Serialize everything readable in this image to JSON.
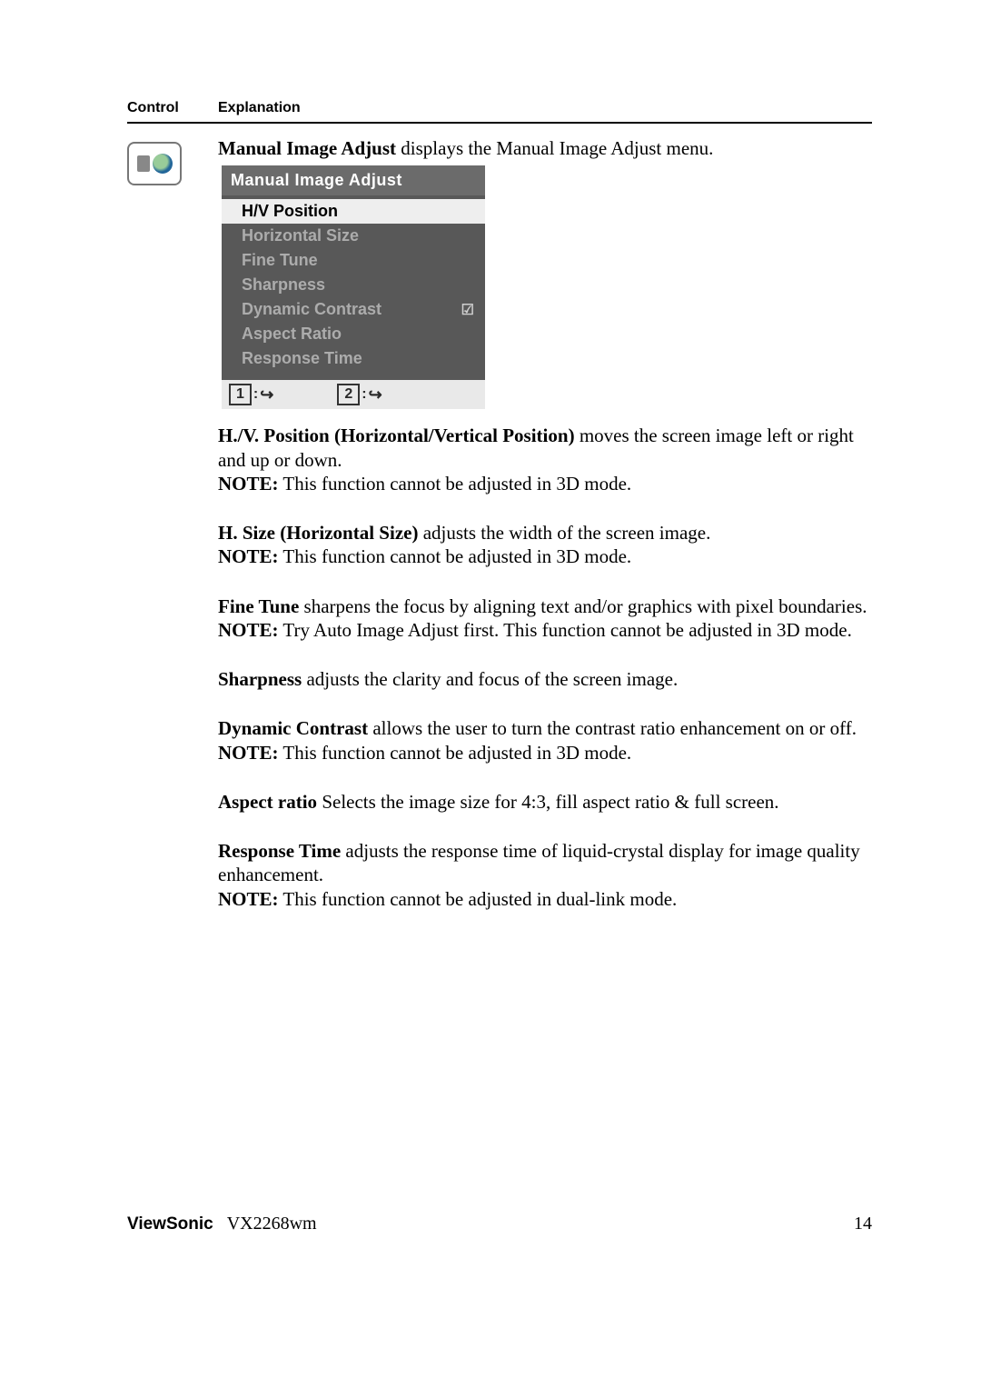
{
  "header": {
    "control": "Control",
    "explanation": "Explanation"
  },
  "intro": {
    "bold": "Manual Image Adjust",
    "rest": " displays the Manual Image Adjust menu."
  },
  "osd": {
    "title": "Manual Image Adjust",
    "items": [
      {
        "label": "H/V Position",
        "selected": true
      },
      {
        "label": "Horizontal Size"
      },
      {
        "label": "Fine Tune"
      },
      {
        "label": "Sharpness"
      },
      {
        "label": "Dynamic Contrast",
        "check": "☑"
      },
      {
        "label": "Aspect Ratio"
      },
      {
        "label": "Response Time"
      }
    ],
    "footer": {
      "key1": "1",
      "key2": "2"
    }
  },
  "sections": {
    "hv": {
      "bold": "H./V. Position (Horizontal/Vertical Position)",
      "rest": " moves the screen image left or right and up or down.",
      "noteLabel": "NOTE:",
      "note": " This function cannot be adjusted in 3D mode."
    },
    "hsize": {
      "bold": "H. Size (Horizontal Size)",
      "rest": " adjusts the width of the screen image.",
      "noteLabel": "NOTE:",
      "note": " This function cannot be adjusted in 3D mode."
    },
    "fine": {
      "bold": "Fine Tune",
      "rest": " sharpens the focus by aligning text and/or graphics with pixel boundaries.",
      "noteLabel": "NOTE:",
      "note": " Try Auto Image Adjust first. This function cannot be adjusted in 3D mode."
    },
    "sharp": {
      "bold": "Sharpness",
      "rest": " adjusts the clarity and focus of the screen image."
    },
    "dyn": {
      "bold": "Dynamic Contrast",
      "rest": " allows the user to turn the contrast ratio enhancement on or off.",
      "noteLabel": "NOTE:",
      "note": " This function cannot be adjusted in 3D mode."
    },
    "aspect": {
      "bold": "Aspect ratio",
      "rest": " Selects the image size for 4:3, fill aspect ratio & full screen."
    },
    "resp": {
      "bold": "Response Time",
      "rest": " adjusts the response time of liquid-crystal display for image quality enhancement.",
      "noteLabel": "NOTE:",
      "note": " This function cannot be adjusted in dual-link mode."
    }
  },
  "footer": {
    "brand": "ViewSonic",
    "model": "VX2268wm",
    "page": "14"
  }
}
